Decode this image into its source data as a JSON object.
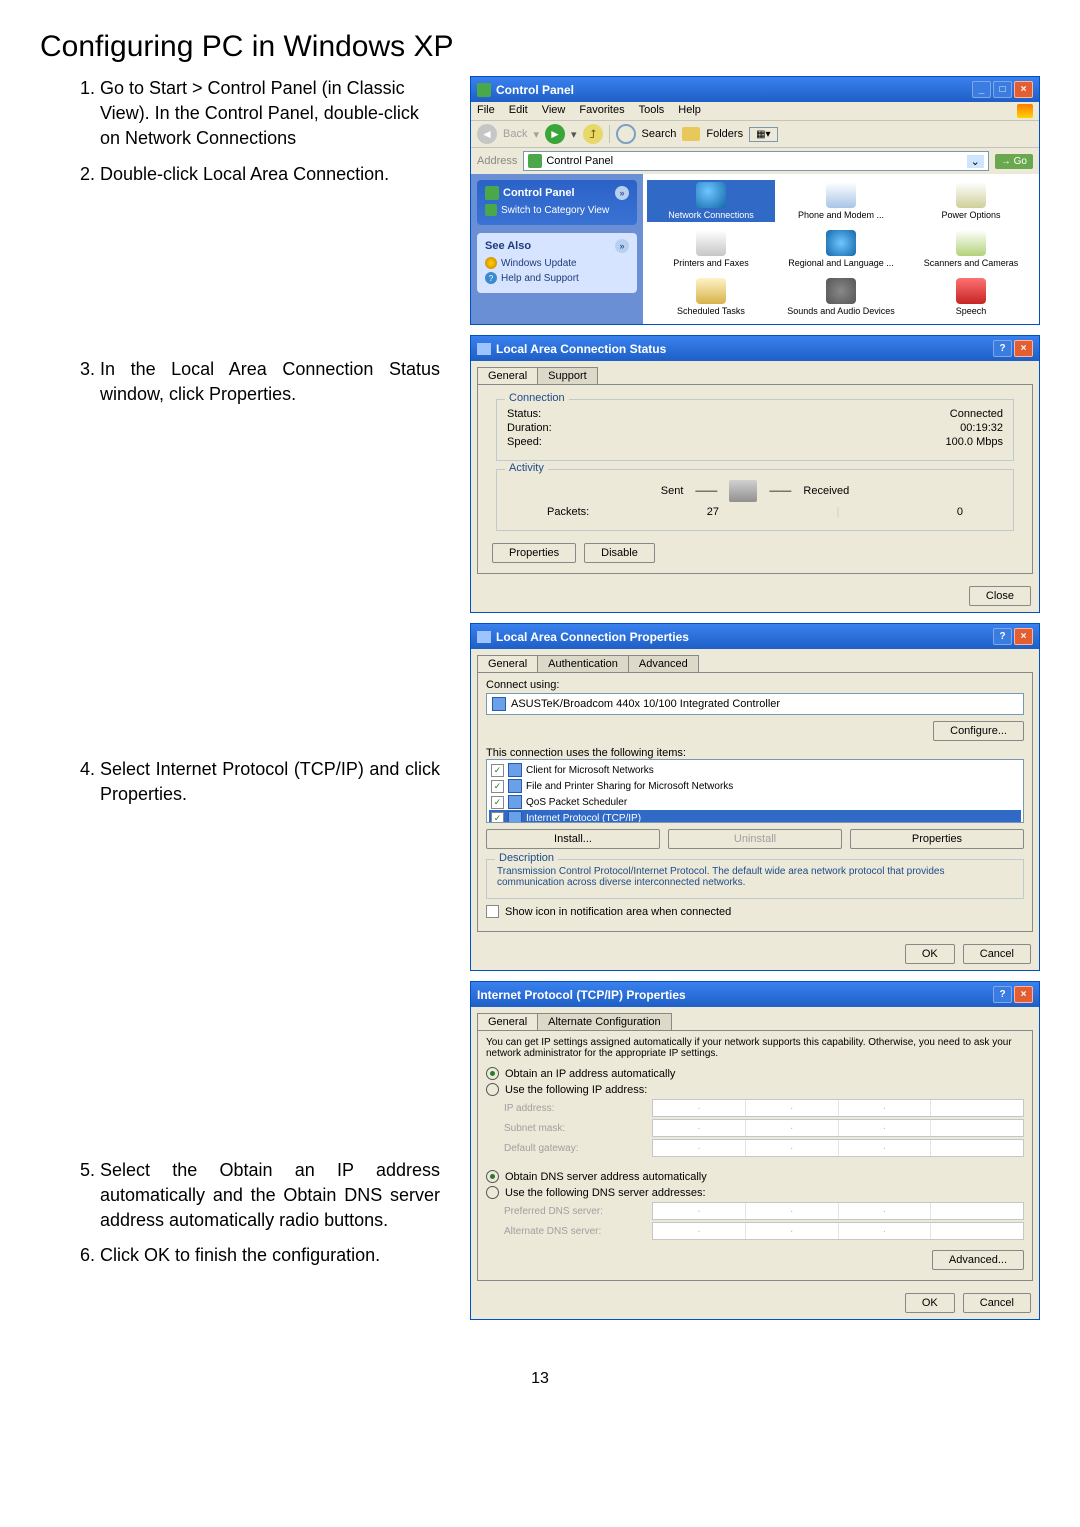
{
  "page": {
    "title": "Configuring PC in Windows XP",
    "number": "13"
  },
  "steps": [
    "Go to Start > Control Panel (in Classic View). In the Control Panel, double-click on Network Connections",
    "Double-click Local Area Connection.",
    "In the Local Area Connection Status window, click Properties.",
    "Select Internet Protocol (TCP/IP) and click Properties.",
    "Select the Obtain an IP address automatically and the Obtain DNS server address automatically radio buttons.",
    "Click OK to finish the configuration."
  ],
  "cp": {
    "title": "Control Panel",
    "menu": [
      "File",
      "Edit",
      "View",
      "Favorites",
      "Tools",
      "Help"
    ],
    "toolbar": {
      "back": "Back",
      "search": "Search",
      "folders": "Folders"
    },
    "address_label": "Address",
    "address_value": "Control Panel",
    "go": "Go",
    "side": {
      "panel_title": "Control Panel",
      "switch": "Switch to Category View",
      "see_also": "See Also",
      "win_update": "Windows Update",
      "help": "Help and Support"
    },
    "icons": {
      "network": "Network Connections",
      "phone": "Phone and Modem ...",
      "power": "Power Options",
      "printers": "Printers and Faxes",
      "regional": "Regional and Language ...",
      "scanners": "Scanners and Cameras",
      "scheduled": "Scheduled Tasks",
      "sounds": "Sounds and Audio Devices",
      "speech": "Speech"
    }
  },
  "lac": {
    "title": "Local Area Connection Status",
    "tabs": {
      "general": "General",
      "support": "Support"
    },
    "conn": {
      "header": "Connection",
      "status_l": "Status:",
      "status_v": "Connected",
      "duration_l": "Duration:",
      "duration_v": "00:19:32",
      "speed_l": "Speed:",
      "speed_v": "100.0 Mbps"
    },
    "act": {
      "header": "Activity",
      "sent": "Sent",
      "received": "Received",
      "packets_l": "Packets:",
      "packets_sent": "27",
      "packets_recv": "0"
    },
    "buttons": {
      "properties": "Properties",
      "disable": "Disable",
      "close": "Close"
    }
  },
  "lacprops": {
    "title": "Local Area Connection Properties",
    "tabs": {
      "general": "General",
      "auth": "Authentication",
      "adv": "Advanced"
    },
    "connect_using": "Connect using:",
    "adapter": "ASUSTeK/Broadcom 440x 10/100 Integrated Controller",
    "configure": "Configure...",
    "uses": "This connection uses the following items:",
    "items": [
      "Client for Microsoft Networks",
      "File and Printer Sharing for Microsoft Networks",
      "QoS Packet Scheduler",
      "Internet Protocol (TCP/IP)"
    ],
    "install": "Install...",
    "uninstall": "Uninstall",
    "properties": "Properties",
    "desc_title": "Description",
    "desc": "Transmission Control Protocol/Internet Protocol. The default wide area network protocol that provides communication across diverse interconnected networks.",
    "show_icon": "Show icon in notification area when connected",
    "ok": "OK",
    "cancel": "Cancel"
  },
  "tcpip": {
    "title": "Internet Protocol (TCP/IP) Properties",
    "tabs": {
      "general": "General",
      "alt": "Alternate Configuration"
    },
    "info": "You can get IP settings assigned automatically if your network supports this capability. Otherwise, you need to ask your network administrator for the appropriate IP settings.",
    "r1": "Obtain an IP address automatically",
    "r2": "Use the following IP address:",
    "ip_l": "IP address:",
    "mask_l": "Subnet mask:",
    "gw_l": "Default gateway:",
    "r3": "Obtain DNS server address automatically",
    "r4": "Use the following DNS server addresses:",
    "pdns_l": "Preferred DNS server:",
    "adns_l": "Alternate DNS server:",
    "advanced": "Advanced...",
    "ok": "OK",
    "cancel": "Cancel"
  }
}
